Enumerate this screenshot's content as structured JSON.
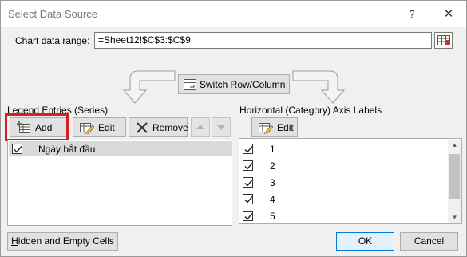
{
  "window": {
    "title": "Select Data Source",
    "help_glyph": "?",
    "close_glyph": "✕"
  },
  "range": {
    "label_pre": "Chart ",
    "label_ul": "d",
    "label_post": "ata range:",
    "value": "=Sheet12!$C$3:$C$9"
  },
  "switch": {
    "label_ul": "W",
    "label_post": "Switch Row/Column"
  },
  "legend": {
    "header": "Legend Entries (Series)",
    "add_ul": "A",
    "add_post": "dd",
    "edit_ul": "E",
    "edit_post": "dit",
    "remove_ul": "R",
    "remove_post": "emove",
    "series": [
      {
        "label": "Ngày bắt đầu",
        "checked": true
      }
    ]
  },
  "axis": {
    "header": "Horizontal (Category) Axis Labels",
    "edit_pre": "Ed",
    "edit_ul": "i",
    "edit_post": "t",
    "items": [
      {
        "label": "1",
        "checked": true
      },
      {
        "label": "2",
        "checked": true
      },
      {
        "label": "3",
        "checked": true
      },
      {
        "label": "4",
        "checked": true
      },
      {
        "label": "5",
        "checked": true
      }
    ]
  },
  "footer": {
    "hidden_ul": "H",
    "hidden_post": "idden and Empty Cells",
    "ok": "OK",
    "cancel": "Cancel"
  },
  "colors": {
    "highlight_outline": "#d42020",
    "selected_row": "#d9d9d9",
    "default_button_border": "#0078d7"
  }
}
